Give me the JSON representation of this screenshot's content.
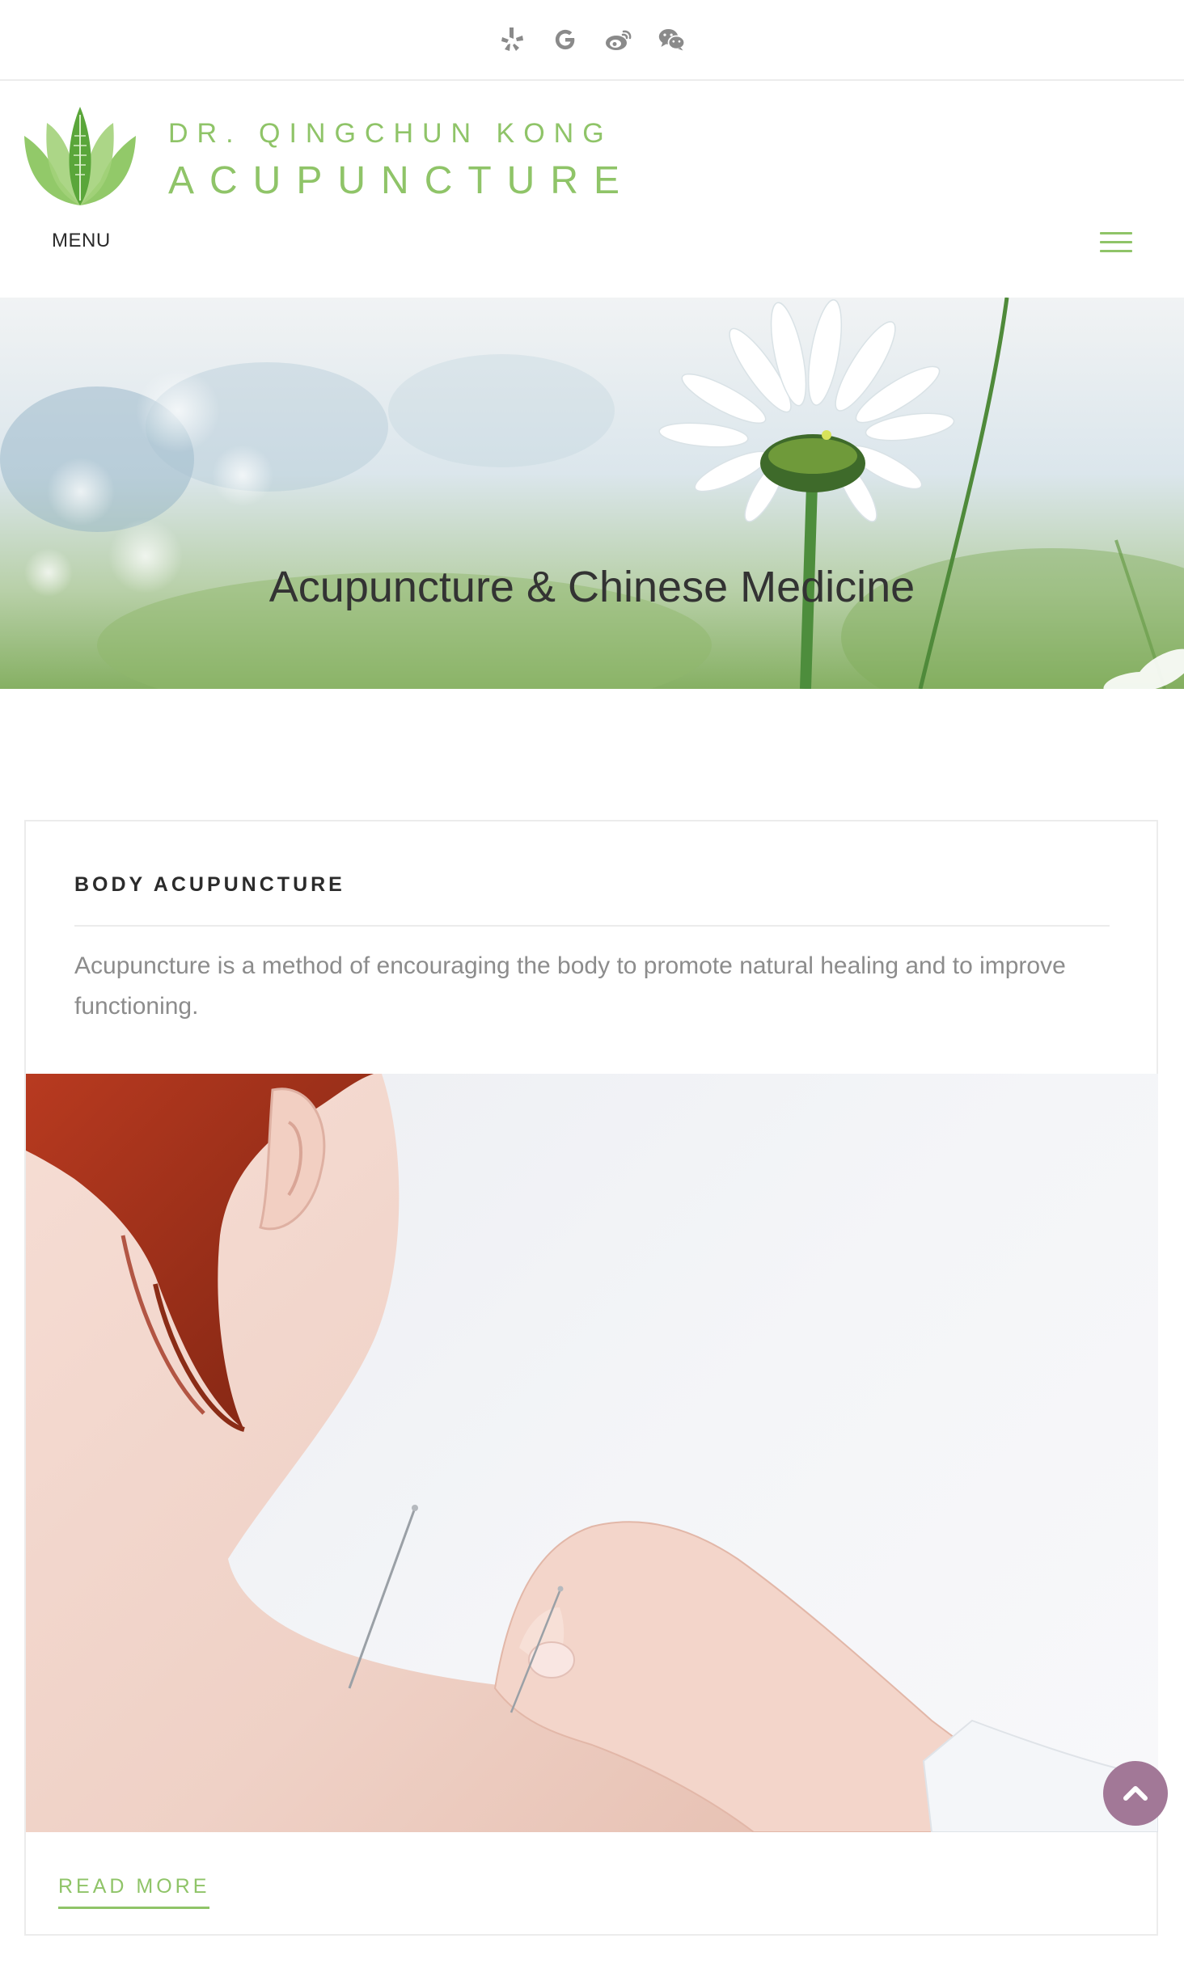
{
  "social": {
    "icons": [
      "yelp-icon",
      "google-icon",
      "weibo-icon",
      "wechat-icon"
    ],
    "icon_color": "#8a8a8a"
  },
  "header": {
    "brand_line1": "DR. QINGCHUN KONG",
    "brand_line2": "ACUPUNCTURE",
    "menu_label": "MENU",
    "brand_color": "#8fc468"
  },
  "hero": {
    "title": "Acupuncture & Chinese Medicine"
  },
  "card": {
    "title": "BODY ACUPUNCTURE",
    "description": "Acupuncture is a method of encouraging the body to promote natural healing and to improve functioning.",
    "read_more": "READ MORE"
  },
  "back_to_top": {
    "icon": "chevron-up-icon",
    "color": "#a27897"
  }
}
